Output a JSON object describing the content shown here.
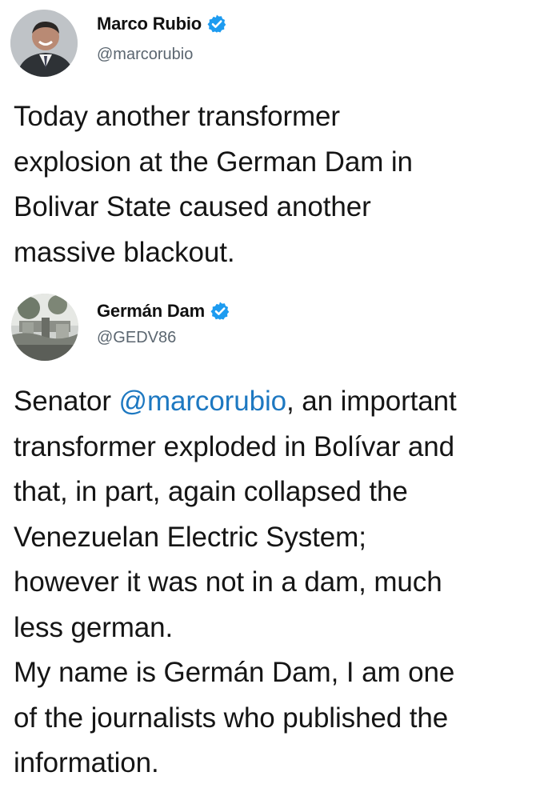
{
  "tweets": [
    {
      "author": {
        "display_name": "Marco Rubio",
        "handle": "@marcorubio",
        "verified_icon": "verified-badge-icon",
        "avatar_icon": "avatar-photo"
      },
      "lines": [
        "Today another transformer",
        "explosion at the German Dam in",
        "Bolivar State caused another",
        "massive blackout."
      ]
    },
    {
      "author": {
        "display_name": "Germán Dam",
        "handle": "@GEDV86",
        "verified_icon": "verified-badge-icon",
        "avatar_icon": "avatar-photo"
      },
      "lines": [
        {
          "prefix": "Senator ",
          "mention": "@marcorubio",
          "suffix": ", an important"
        },
        "transformer exploded in Bolívar and",
        "that, in part, again collapsed the",
        "Venezuelan Electric System;",
        "however it was not in a dam, much",
        "less german.",
        "My name is Germán Dam, I am one",
        "of the journalists who published the",
        "information."
      ]
    }
  ],
  "colors": {
    "verified": "#1d9bf0",
    "mention": "#1d78c1",
    "handle": "#5b6670",
    "text": "#151515"
  }
}
